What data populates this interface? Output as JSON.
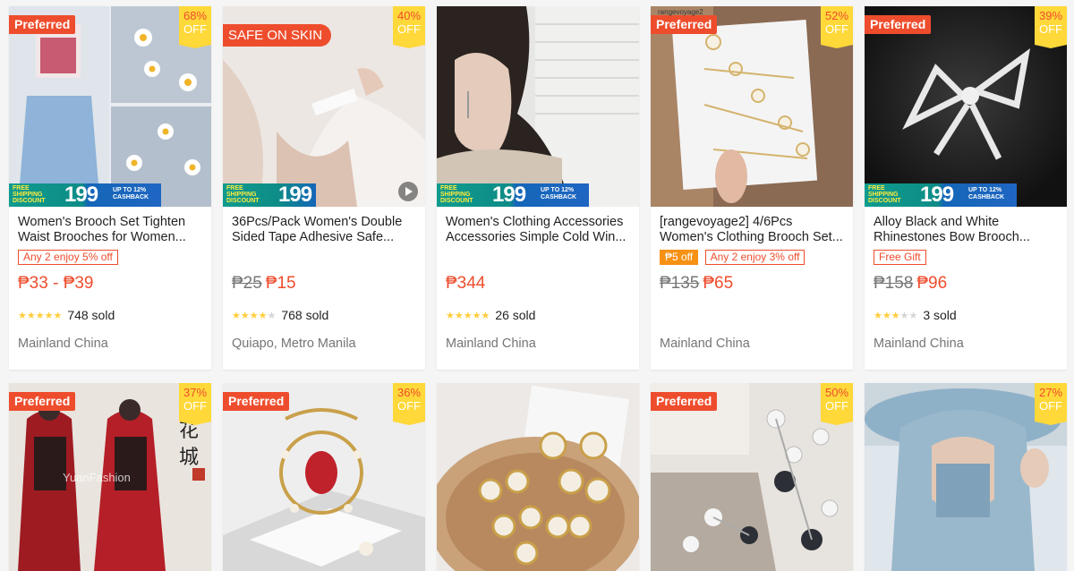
{
  "colors": {
    "accent": "#ee4d2d",
    "discount_bg": "#ffd839",
    "star": "#ffce3d"
  },
  "labels": {
    "preferred": "Preferred",
    "off": "OFF"
  },
  "banner": {
    "free_shipping": "FREE SHIPPING DISCOUNT",
    "amount": "199",
    "cashback": "UP TO 12% CASHBACK"
  },
  "row1": [
    {
      "title": "Women's Brooch Set Tighten Waist Brooches for Women...",
      "discount": "68%",
      "tag": "Any 2 enjoy 5% off",
      "price": "₱33 - ₱39",
      "rating": 5,
      "sold": "748 sold",
      "location": "Mainland China"
    },
    {
      "title": "36Pcs/Pack Women's Double Sided Tape Adhesive Safe...",
      "discount": "40%",
      "overlay": "SAFE ON SKIN",
      "old_price": "₱25",
      "price": "₱15",
      "rating": 4.5,
      "sold": "768 sold",
      "location": "Quiapo, Metro Manila"
    },
    {
      "title": "Women's Clothing Accessories Accessories Simple Cold Win...",
      "price": "₱344",
      "rating": 5,
      "sold": "26 sold",
      "location": "Mainland China"
    },
    {
      "title": "[rangevoyage2] 4/6Pcs Women's Clothing Brooch Set...",
      "discount": "52%",
      "watermark": "rangevoyage2",
      "voucher": "₱5 off",
      "tag": "Any 2 enjoy 3% off",
      "old_price": "₱135",
      "price": "₱65",
      "location": "Mainland China"
    },
    {
      "title": "Alloy Black and White Rhinestones Bow Brooch...",
      "discount": "39%",
      "tag": "Free Gift",
      "old_price": "₱158",
      "price": "₱96",
      "rating": 3,
      "sold": "3 sold",
      "location": "Mainland China"
    }
  ],
  "row2": [
    {
      "discount": "37%",
      "watermark": "YuanFashion"
    },
    {
      "discount": "36%"
    },
    {},
    {
      "discount": "50%"
    },
    {
      "discount": "27%"
    }
  ]
}
